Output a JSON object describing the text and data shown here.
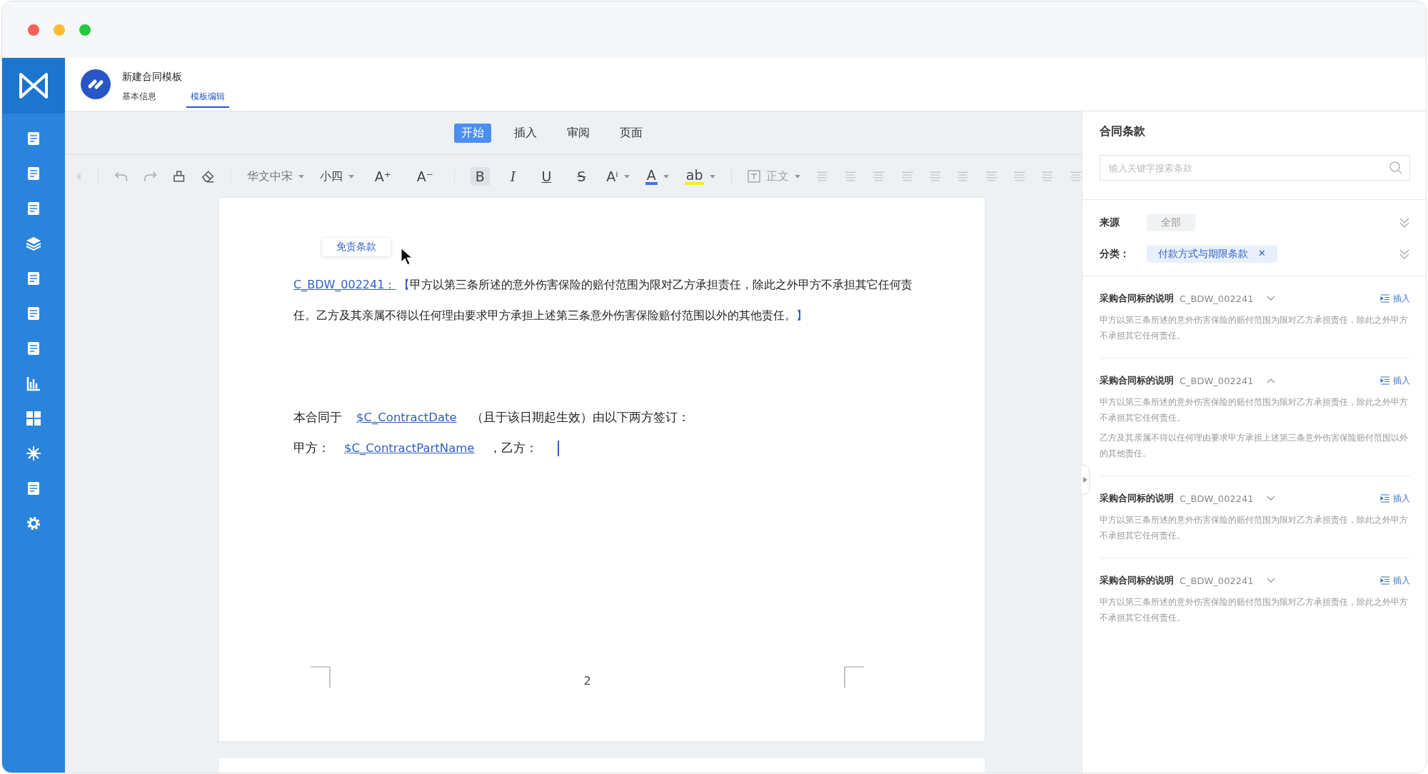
{
  "window": {
    "controls": [
      {
        "color": "#fe5f57"
      },
      {
        "color": "#febb2e"
      },
      {
        "color": "#27c840"
      }
    ]
  },
  "header": {
    "title": "新建合同模板",
    "tabs": [
      {
        "label": "基本信息",
        "selected": false
      },
      {
        "label": "模板编辑",
        "selected": true
      }
    ]
  },
  "menu_tabs": [
    {
      "label": "开始",
      "selected": true
    },
    {
      "label": "插入",
      "selected": false
    },
    {
      "label": "审阅",
      "selected": false
    },
    {
      "label": "页面",
      "selected": false
    }
  ],
  "toolbar": {
    "font": "华文中宋",
    "size": "小四",
    "size_buttons": [
      "A⁺",
      "A⁻"
    ],
    "format_buttons": [
      {
        "kind": "bold",
        "label": "B",
        "selected": true
      },
      {
        "kind": "italic",
        "label": "I",
        "selected": false
      },
      {
        "kind": "underline",
        "label": "U",
        "selected": false
      },
      {
        "kind": "strike",
        "label": "S",
        "selected": false
      }
    ],
    "script_button": "Aⁱ",
    "color_buttons": [
      {
        "label": "A",
        "color": "#3a78e6"
      },
      {
        "label": "ab",
        "color": "#f5ea2a"
      }
    ],
    "style": {
      "value": "正文",
      "disabled": true
    }
  },
  "document": {
    "tooltip": "免责条款",
    "clause": {
      "code": "C_BDW_002241：",
      "open": "【",
      "text": "甲方以第三条所述的意外伤害保险的赔付范围为限对乙方承担责任，除此之外甲方不承担其它任何责任。乙方及其亲属不得以任何理由要求甲方承担上述第三条意外伤害保险赔付范围以外的其他责任。",
      "close": "】"
    },
    "lines": [
      [
        {
          "kind": "text",
          "text": "本合同于"
        },
        {
          "kind": "field",
          "text": "$C_ContractDate"
        },
        {
          "kind": "text",
          "text": "（且于该日期起生效）由以下两方签订："
        }
      ],
      [
        {
          "kind": "text",
          "text": "甲方："
        },
        {
          "kind": "field",
          "text": "$C_ContractPartName"
        },
        {
          "kind": "text",
          "text": "，乙方："
        },
        {
          "kind": "cursor"
        }
      ]
    ],
    "page_number": "2"
  },
  "panel": {
    "title": "合同条款",
    "search": {
      "placeholder": "输入关键字搜索条款"
    },
    "filters": [
      {
        "kind": "plain",
        "label": "来源",
        "chip": "全部"
      },
      {
        "kind": "removable",
        "label": "分类：",
        "chip": "付款方式与期限条款",
        "remove": "✕"
      }
    ],
    "clauses": [
      {
        "name": "采购合同标的说明",
        "code": "C_BDW_002241",
        "expanded": false,
        "action": "插入",
        "paragraphs": [
          "甲方以第三条所述的意外伤害保险的赔付范围为限对乙方承担责任，除此之外甲方不承担其它任何责任。"
        ]
      },
      {
        "name": "采购合同标的说明",
        "code": "C_BDW_002241",
        "expanded": true,
        "action": "插入",
        "paragraphs": [
          "甲方以第三条所述的意外伤害保险的赔付范围为限对乙方承担责任，除此之外甲方不承担其它任何责任。",
          "乙方及其亲属不得以任何理由要求甲方承担上述第三条意外伤害保险赔付范围以外的其他责任。"
        ]
      },
      {
        "name": "采购合同标的说明",
        "code": "C_BDW_002241",
        "expanded": false,
        "action": "插入",
        "paragraphs": [
          "甲方以第三条所述的意外伤害保险的赔付范围为限对乙方承担责任，除此之外甲方不承担其它任何责任。"
        ]
      },
      {
        "name": "采购合同标的说明",
        "code": "C_BDW_002241",
        "expanded": false,
        "action": "插入",
        "paragraphs": [
          "甲方以第三条所述的意外伤害保险的赔付范围为限对乙方承担责任，除此之外甲方不承担其它任何责任。"
        ]
      }
    ]
  }
}
